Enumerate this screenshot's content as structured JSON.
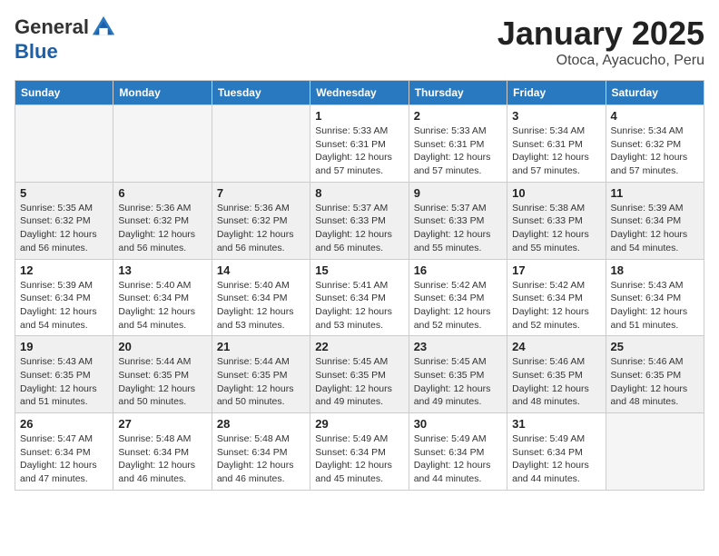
{
  "logo": {
    "general": "General",
    "blue": "Blue"
  },
  "title": "January 2025",
  "subtitle": "Otoca, Ayacucho, Peru",
  "days_of_week": [
    "Sunday",
    "Monday",
    "Tuesday",
    "Wednesday",
    "Thursday",
    "Friday",
    "Saturday"
  ],
  "weeks": [
    [
      {
        "day": "",
        "info": ""
      },
      {
        "day": "",
        "info": ""
      },
      {
        "day": "",
        "info": ""
      },
      {
        "day": "1",
        "info": "Sunrise: 5:33 AM\nSunset: 6:31 PM\nDaylight: 12 hours\nand 57 minutes."
      },
      {
        "day": "2",
        "info": "Sunrise: 5:33 AM\nSunset: 6:31 PM\nDaylight: 12 hours\nand 57 minutes."
      },
      {
        "day": "3",
        "info": "Sunrise: 5:34 AM\nSunset: 6:31 PM\nDaylight: 12 hours\nand 57 minutes."
      },
      {
        "day": "4",
        "info": "Sunrise: 5:34 AM\nSunset: 6:32 PM\nDaylight: 12 hours\nand 57 minutes."
      }
    ],
    [
      {
        "day": "5",
        "info": "Sunrise: 5:35 AM\nSunset: 6:32 PM\nDaylight: 12 hours\nand 56 minutes."
      },
      {
        "day": "6",
        "info": "Sunrise: 5:36 AM\nSunset: 6:32 PM\nDaylight: 12 hours\nand 56 minutes."
      },
      {
        "day": "7",
        "info": "Sunrise: 5:36 AM\nSunset: 6:32 PM\nDaylight: 12 hours\nand 56 minutes."
      },
      {
        "day": "8",
        "info": "Sunrise: 5:37 AM\nSunset: 6:33 PM\nDaylight: 12 hours\nand 56 minutes."
      },
      {
        "day": "9",
        "info": "Sunrise: 5:37 AM\nSunset: 6:33 PM\nDaylight: 12 hours\nand 55 minutes."
      },
      {
        "day": "10",
        "info": "Sunrise: 5:38 AM\nSunset: 6:33 PM\nDaylight: 12 hours\nand 55 minutes."
      },
      {
        "day": "11",
        "info": "Sunrise: 5:39 AM\nSunset: 6:34 PM\nDaylight: 12 hours\nand 54 minutes."
      }
    ],
    [
      {
        "day": "12",
        "info": "Sunrise: 5:39 AM\nSunset: 6:34 PM\nDaylight: 12 hours\nand 54 minutes."
      },
      {
        "day": "13",
        "info": "Sunrise: 5:40 AM\nSunset: 6:34 PM\nDaylight: 12 hours\nand 54 minutes."
      },
      {
        "day": "14",
        "info": "Sunrise: 5:40 AM\nSunset: 6:34 PM\nDaylight: 12 hours\nand 53 minutes."
      },
      {
        "day": "15",
        "info": "Sunrise: 5:41 AM\nSunset: 6:34 PM\nDaylight: 12 hours\nand 53 minutes."
      },
      {
        "day": "16",
        "info": "Sunrise: 5:42 AM\nSunset: 6:34 PM\nDaylight: 12 hours\nand 52 minutes."
      },
      {
        "day": "17",
        "info": "Sunrise: 5:42 AM\nSunset: 6:34 PM\nDaylight: 12 hours\nand 52 minutes."
      },
      {
        "day": "18",
        "info": "Sunrise: 5:43 AM\nSunset: 6:34 PM\nDaylight: 12 hours\nand 51 minutes."
      }
    ],
    [
      {
        "day": "19",
        "info": "Sunrise: 5:43 AM\nSunset: 6:35 PM\nDaylight: 12 hours\nand 51 minutes."
      },
      {
        "day": "20",
        "info": "Sunrise: 5:44 AM\nSunset: 6:35 PM\nDaylight: 12 hours\nand 50 minutes."
      },
      {
        "day": "21",
        "info": "Sunrise: 5:44 AM\nSunset: 6:35 PM\nDaylight: 12 hours\nand 50 minutes."
      },
      {
        "day": "22",
        "info": "Sunrise: 5:45 AM\nSunset: 6:35 PM\nDaylight: 12 hours\nand 49 minutes."
      },
      {
        "day": "23",
        "info": "Sunrise: 5:45 AM\nSunset: 6:35 PM\nDaylight: 12 hours\nand 49 minutes."
      },
      {
        "day": "24",
        "info": "Sunrise: 5:46 AM\nSunset: 6:35 PM\nDaylight: 12 hours\nand 48 minutes."
      },
      {
        "day": "25",
        "info": "Sunrise: 5:46 AM\nSunset: 6:35 PM\nDaylight: 12 hours\nand 48 minutes."
      }
    ],
    [
      {
        "day": "26",
        "info": "Sunrise: 5:47 AM\nSunset: 6:34 PM\nDaylight: 12 hours\nand 47 minutes."
      },
      {
        "day": "27",
        "info": "Sunrise: 5:48 AM\nSunset: 6:34 PM\nDaylight: 12 hours\nand 46 minutes."
      },
      {
        "day": "28",
        "info": "Sunrise: 5:48 AM\nSunset: 6:34 PM\nDaylight: 12 hours\nand 46 minutes."
      },
      {
        "day": "29",
        "info": "Sunrise: 5:49 AM\nSunset: 6:34 PM\nDaylight: 12 hours\nand 45 minutes."
      },
      {
        "day": "30",
        "info": "Sunrise: 5:49 AM\nSunset: 6:34 PM\nDaylight: 12 hours\nand 44 minutes."
      },
      {
        "day": "31",
        "info": "Sunrise: 5:49 AM\nSunset: 6:34 PM\nDaylight: 12 hours\nand 44 minutes."
      },
      {
        "day": "",
        "info": ""
      }
    ]
  ]
}
